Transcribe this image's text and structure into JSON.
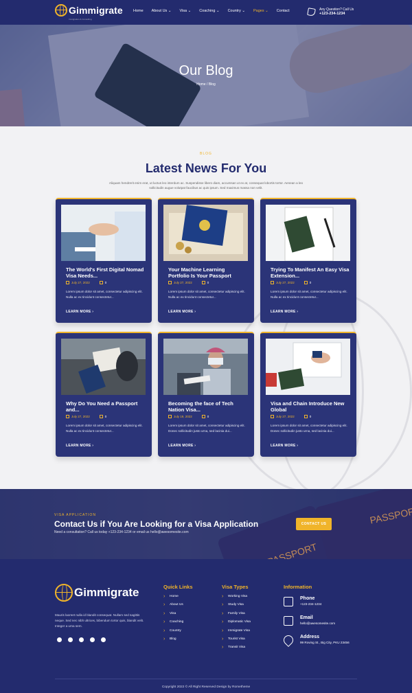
{
  "header": {
    "logo_text": "Gimmigrate",
    "logo_sub": "Immigration & Consulting",
    "nav": [
      "Home",
      "About Us ⌄",
      "Visa ⌄",
      "Coaching ⌄",
      "Country ⌄",
      "Pages ⌄",
      "Contact"
    ],
    "question_label": "Any Question? Call Us",
    "phone": "+123-234-1234"
  },
  "hero": {
    "title": "Our Blog",
    "breadcrumb": "Home / Blog"
  },
  "blog": {
    "label": "BLOG",
    "title": "Latest News For You",
    "intro": "Aliquam hendrerit enim erat, ut luctus leo interdum ac. Suspendisse libero diam, accumsan ut ex at, consequat lobortis tortor. Aenean a leo sollicitudin augue volutpat faucibus ac quis ipsum. Sed maximus massa non velit.",
    "cards": [
      {
        "title": "The World's First Digital Nomad Visa Needs...",
        "date": "July 27, 2022",
        "comments": "0",
        "excerpt": "Lorem ipsum dolor sit amet, consectetur adipiscing elit. Nulla ac ex tincidunt consectetur...",
        "more": "LEARN MORE ›"
      },
      {
        "title": "Your Machine Learning Portfolio Is Your Passport",
        "date": "July 27, 2022",
        "comments": "0",
        "excerpt": "Lorem ipsum dolor sit amet, consectetur adipiscing elit. Nulla ac ex tincidunt consectetur...",
        "more": "LEARN MORE ›"
      },
      {
        "title": "Trying To Manifest An Easy Visa Extension...",
        "date": "July 27, 2022",
        "comments": "0",
        "excerpt": "Lorem ipsum dolor sit amet, consectetur adipiscing elit. Nulla ac ex tincidunt consectetur...",
        "more": "LEARN MORE ›"
      },
      {
        "title": "Why Do You Need a Passport and...",
        "date": "July 27, 2022",
        "comments": "0",
        "excerpt": "Lorem ipsum dolor sit amet, consectetur adipiscing elit. Nulla ac ex tincidunt consectetur...",
        "more": "LEARN MORE ›"
      },
      {
        "title": "Becoming the face of Tech Nation Visa...",
        "date": "July 19, 2022",
        "comments": "0",
        "excerpt": "Lorem ipsum dolor sit amet, consectetur adipiscing elit. Donec sollicitudin justo urna, sed lacinia dui...",
        "more": "LEARN MORE ›"
      },
      {
        "title": "Visa and Chain Introduce New Global",
        "date": "July 27, 2022",
        "comments": "0",
        "excerpt": "Lorem ipsum dolor sit amet, consectetur adipiscing elit. Donec sollicitudin justo urna, sed lacinia dui...",
        "more": "LEARN MORE ›"
      }
    ]
  },
  "cta": {
    "label": "VISA APPLICATION",
    "title": "Contact Us if You Are Looking for a Visa Application",
    "subtitle": "Need a consultation? Call us today +123-234-1234 or email us hello@awesomesite.com",
    "button": "CONTACT US",
    "passport_text": "PASSPORT"
  },
  "footer": {
    "logo_text": "Gimmigrate",
    "about": "Mauris laoreet nulla id blandit consequat. Nullam sed sagittis neque. Sed nec nibh ultrices, bibendum tortor quis, blandit velit. Integer a urna sem.",
    "quick_links_title": "Quick Links",
    "quick_links": [
      "Home",
      "About Us",
      "Visa",
      "Coaching",
      "Country",
      "Blog"
    ],
    "visa_types_title": "Visa Types",
    "visa_types": [
      "Working Visa",
      "Study Visa",
      "Family Visa",
      "Diplomatic Visa",
      "Immigrate Visa",
      "Tourist Visa",
      "Transit Visa"
    ],
    "info_title": "Information",
    "phone_label": "Phone",
    "phone": "+123-234-1234",
    "email_label": "Email",
    "email": "hello@awesomesite.com",
    "address_label": "Address",
    "address": "99 Roving St., Big City, PKU 23456",
    "copyright": "Copyright 2022 © All Right Reserved Design by Rometheme"
  },
  "colors": {
    "navy": "#232b6e",
    "accent": "#f0b42a"
  }
}
